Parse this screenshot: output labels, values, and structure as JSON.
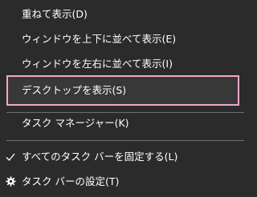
{
  "menu": {
    "items": [
      {
        "label": "重ねて表示(D)"
      },
      {
        "label": "ウィンドウを上下に並べて表示(E)"
      },
      {
        "label": "ウィンドウを左右に並べて表示(I)"
      },
      {
        "label": "デスクトップを表示(S)"
      },
      {
        "label": "タスク マネージャー(K)"
      },
      {
        "label": "すべてのタスク バーを固定する(L)",
        "icon": "checkmark-icon"
      },
      {
        "label": "タスク バーの設定(T)",
        "icon": "gear-icon"
      }
    ]
  },
  "colors": {
    "background": "#2b2b2b",
    "text": "#ffffff",
    "separator": "#6e6e6e",
    "highlight_border": "#f2a6c8",
    "highlight_fill": "#383838"
  }
}
